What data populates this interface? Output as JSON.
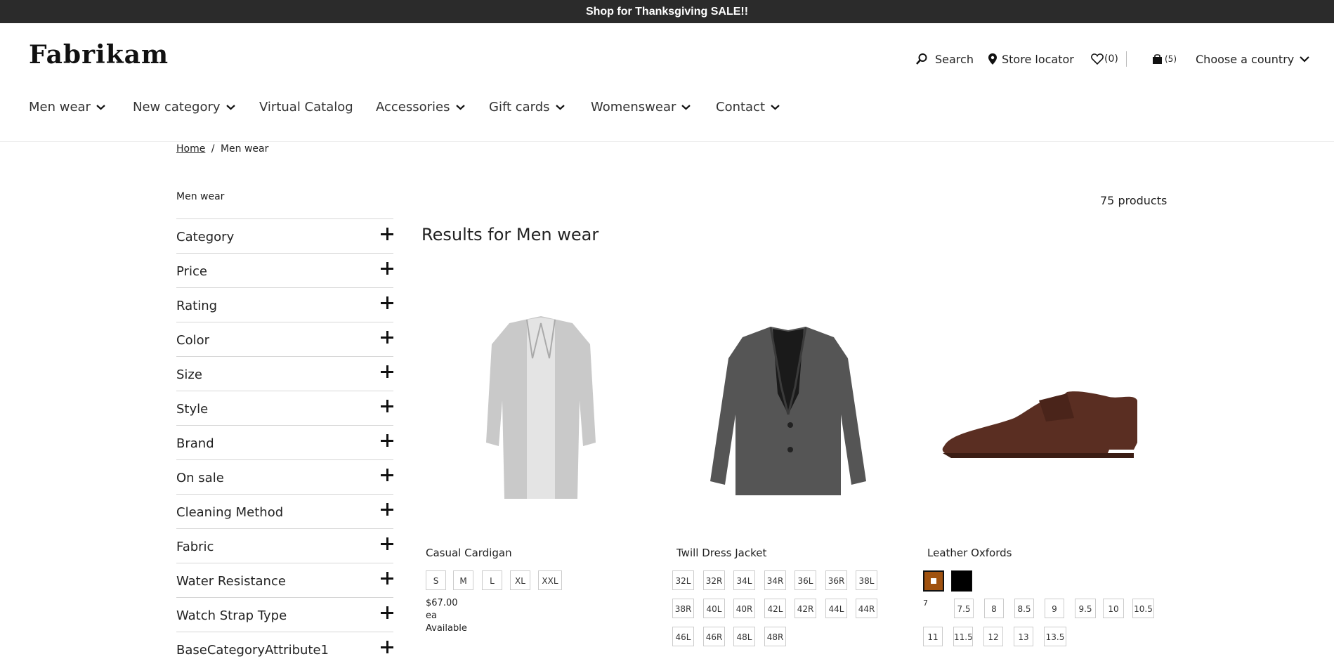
{
  "promo": {
    "text": "Shop for Thanksgiving SALE!!"
  },
  "brand": {
    "logo": "Fabrikam"
  },
  "utility": {
    "search": "Search",
    "store_locator": "Store locator",
    "wishlist_count": "(0)",
    "cart_count": "(5)",
    "country": "Choose a country"
  },
  "nav": [
    {
      "label": "Men wear",
      "has_menu": true
    },
    {
      "label": "New category",
      "has_menu": true
    },
    {
      "label": "Virtual Catalog",
      "has_menu": false
    },
    {
      "label": "Accessories",
      "has_menu": true
    },
    {
      "label": "Gift cards",
      "has_menu": true
    },
    {
      "label": "Womenswear",
      "has_menu": true
    },
    {
      "label": "Contact",
      "has_menu": true
    }
  ],
  "breadcrumb": {
    "home": "Home",
    "separator": "/",
    "current": "Men wear"
  },
  "refiner_heading": "Men wear",
  "product_count": "75 products",
  "results_title": "Results for Men wear",
  "facets": [
    "Category",
    "Price",
    "Rating",
    "Color",
    "Size",
    "Style",
    "Brand",
    "On sale",
    "Cleaning Method",
    "Fabric",
    "Water Resistance",
    "Watch Strap Type",
    "BaseCategoryAttribute1"
  ],
  "products": [
    {
      "name": "Casual Cardigan",
      "sizes": [
        "S",
        "M",
        "L",
        "XL",
        "XXL"
      ],
      "price": "$67.00",
      "unit": "ea",
      "availability": "Available"
    },
    {
      "name": "Twill Dress Jacket",
      "sizes": [
        "32L",
        "32R",
        "34L",
        "34R",
        "36L",
        "36R",
        "38L",
        "38R",
        "40L",
        "40R",
        "42L",
        "42R",
        "44L",
        "44R",
        "46L",
        "46R",
        "48L",
        "48R"
      ]
    },
    {
      "name": "Leather Oxfords",
      "colors": [
        "#a0520f",
        "#000000"
      ],
      "broken_image_alt": "7",
      "sizes": [
        "7.5",
        "8",
        "8.5",
        "9",
        "9.5",
        "10",
        "10.5",
        "11",
        "11.5",
        "12",
        "13",
        "13.5"
      ]
    }
  ]
}
